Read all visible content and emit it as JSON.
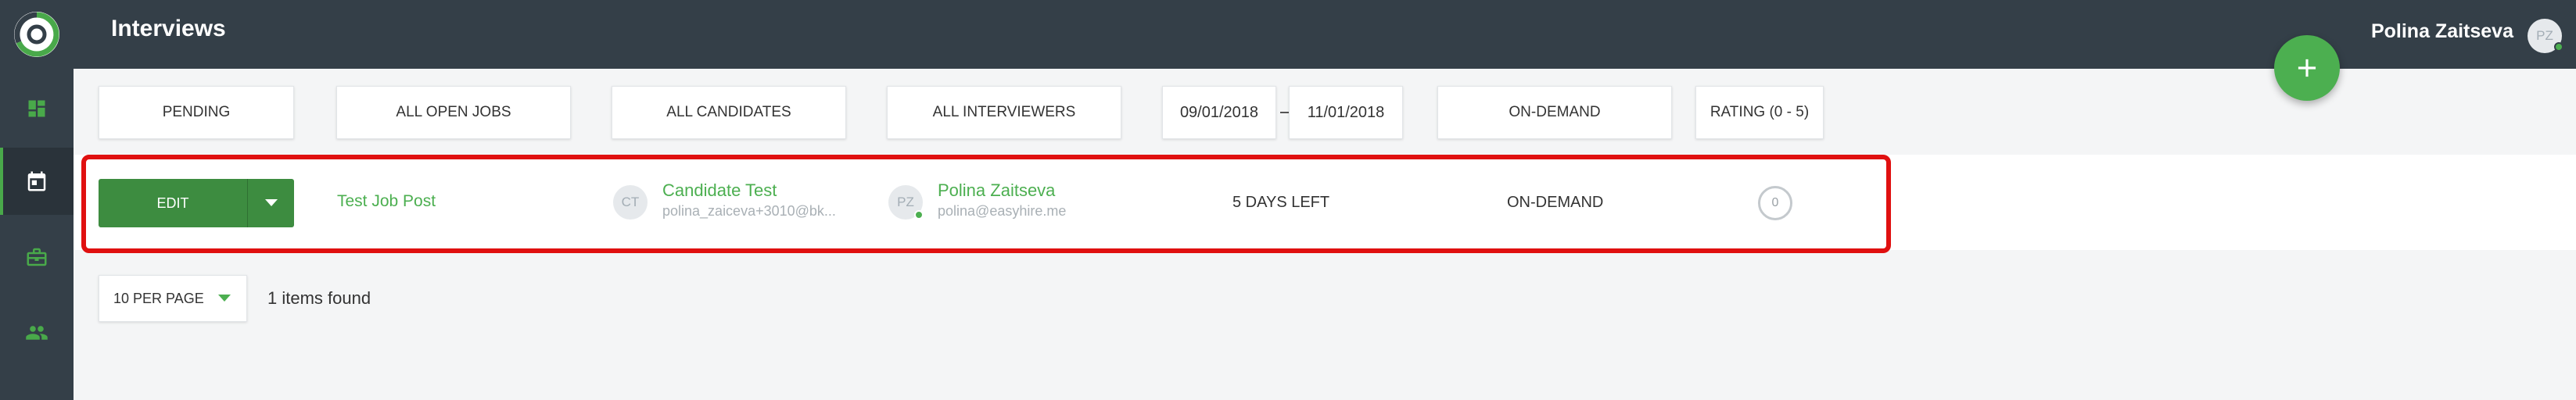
{
  "app": {
    "page_title": "Interviews",
    "user": {
      "name": "Polina Zaitseva",
      "initials": "PZ"
    }
  },
  "sidebar": {
    "items": [
      {
        "name": "dashboard",
        "icon": "dashboard-icon"
      },
      {
        "name": "interviews",
        "icon": "calendar-icon",
        "active": true
      },
      {
        "name": "jobs",
        "icon": "briefcase-icon"
      },
      {
        "name": "candidates",
        "icon": "people-icon"
      }
    ]
  },
  "filters": {
    "status": "PENDING",
    "jobs": "ALL OPEN JOBS",
    "candidates": "ALL CANDIDATES",
    "interviewers": "ALL INTERVIEWERS",
    "date_from": "09/01/2018",
    "date_to": "11/01/2018",
    "type": "ON-DEMAND",
    "rating": "RATING (0 - 5)"
  },
  "interview": {
    "edit_label": "EDIT",
    "job": "Test Job Post",
    "candidate": {
      "initials": "CT",
      "name": "Candidate Test",
      "email": "polina_zaiceva+3010@bk..."
    },
    "interviewer": {
      "initials": "PZ",
      "name": "Polina Zaitseva",
      "email": "polina@easyhire.me"
    },
    "time_left": "5 DAYS LEFT",
    "type": "ON-DEMAND",
    "rating": "0"
  },
  "pagination": {
    "per_page": "10 PER PAGE",
    "items_found": "1 items found"
  },
  "colors": {
    "sidebar": "#343f48",
    "accent": "#4caf50",
    "edit_button": "#3d8c40",
    "highlight": "#e01010"
  }
}
